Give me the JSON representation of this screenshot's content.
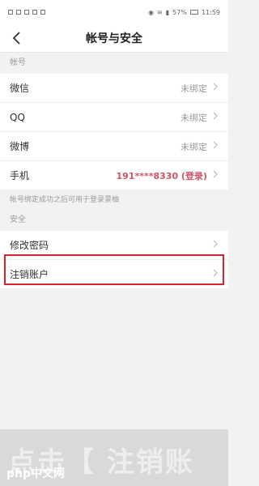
{
  "status_bar": {
    "time": "11:59",
    "battery": "57%"
  },
  "header": {
    "title": "帐号与安全"
  },
  "sections": {
    "account_label": "帐号",
    "security_label": "安全"
  },
  "account": {
    "items": [
      {
        "label": "微信",
        "value": "未绑定"
      },
      {
        "label": "QQ",
        "value": "未绑定"
      },
      {
        "label": "微博",
        "value": "未绑定"
      },
      {
        "label": "手机",
        "value": "191****8330 (登录)"
      }
    ],
    "note": "帐号绑定成功之后可用于登录景柚"
  },
  "security": {
    "items": [
      {
        "label": "修改密码"
      },
      {
        "label": "注销账户"
      }
    ]
  },
  "bottom_overlay": {
    "text": "点击【 注销账",
    "watermark": "php中文网"
  },
  "colors": {
    "accent_phone": "#d15466",
    "highlight": "#d6262b"
  }
}
